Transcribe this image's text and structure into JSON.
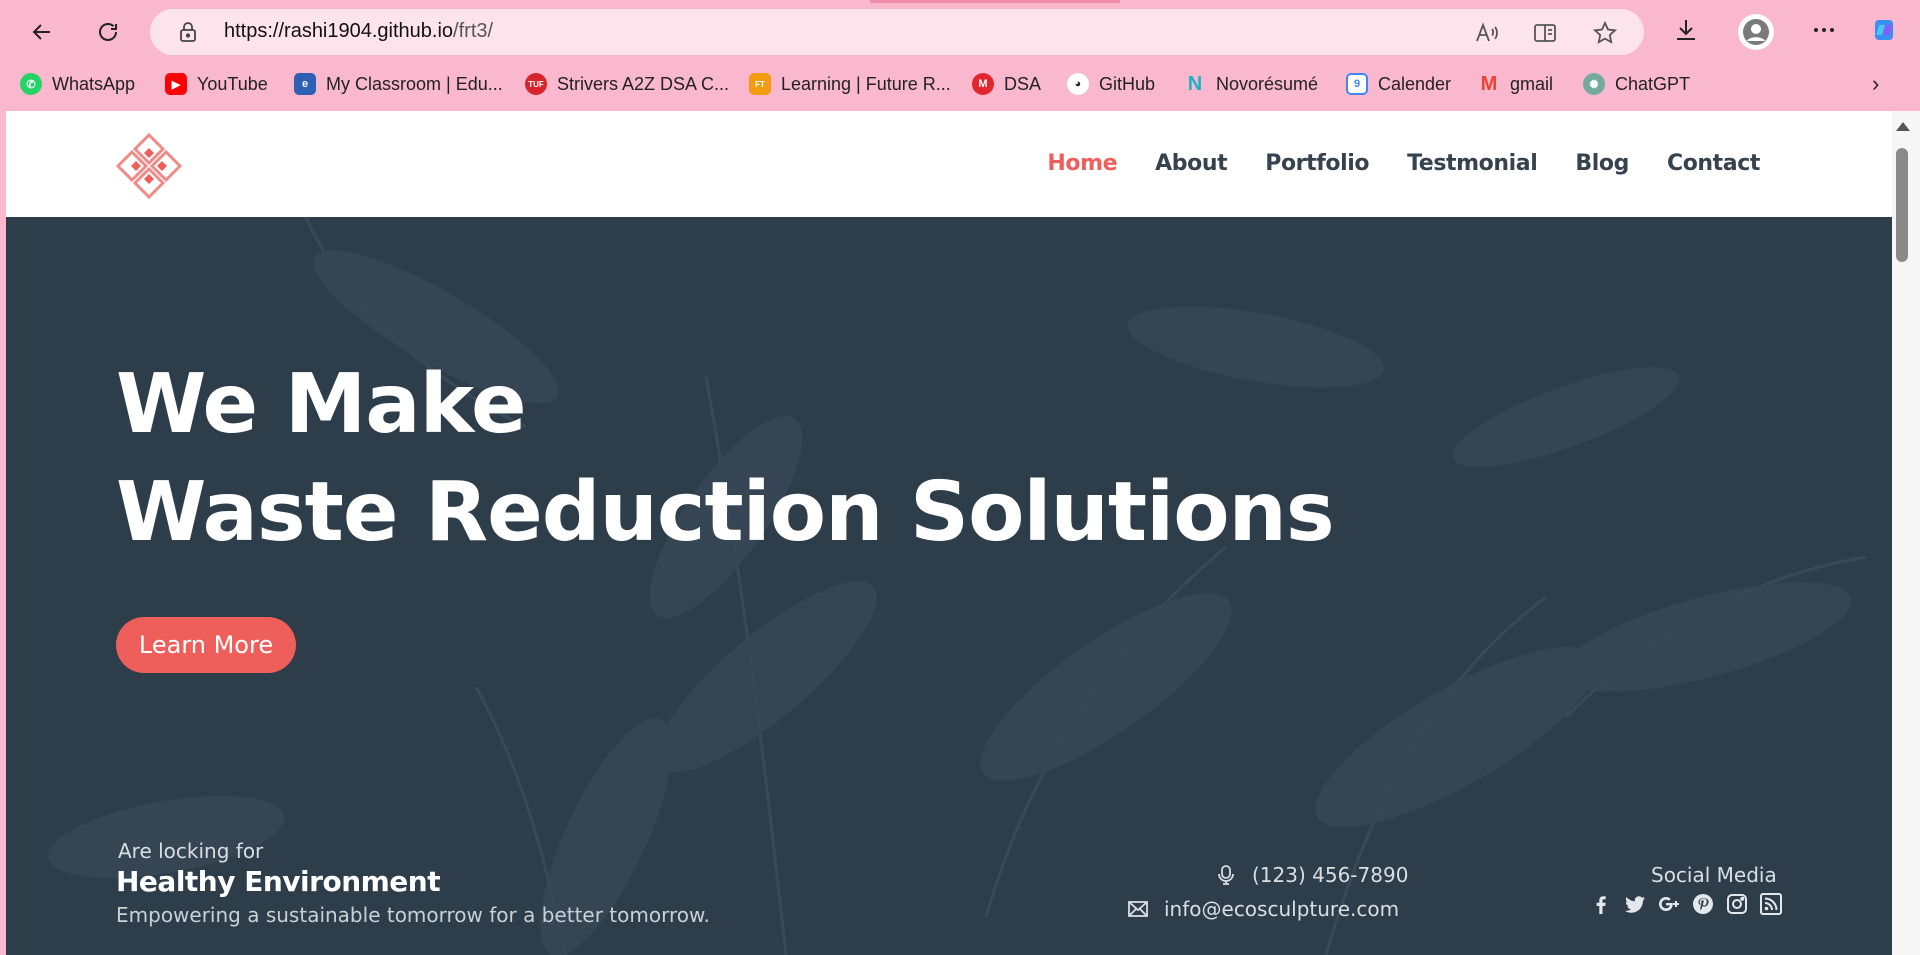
{
  "browser": {
    "url_host": "https://rashi1904.github.io",
    "url_path": "/frt3/",
    "bookmarks": [
      {
        "label": "WhatsApp",
        "icon": "whatsapp-icon",
        "color": "#25d366"
      },
      {
        "label": "YouTube",
        "icon": "youtube-icon",
        "color": "#ff0000"
      },
      {
        "label": "My Classroom | Edu...",
        "icon": "classroom-icon",
        "color": "#2d5fb3"
      },
      {
        "label": "Strivers A2Z DSA C...",
        "icon": "tuf-icon",
        "color": "#d9232d"
      },
      {
        "label": "Learning | Future R...",
        "icon": "future-talent-icon",
        "color": "#f39c12"
      },
      {
        "label": "DSA",
        "icon": "dsa-icon",
        "color": "#e3262e"
      },
      {
        "label": "GitHub",
        "icon": "github-icon",
        "color": "#ffffff"
      },
      {
        "label": "Novorésumé",
        "icon": "novoresume-icon",
        "color": "#1bb3c4"
      },
      {
        "label": "Calender",
        "icon": "calendar-icon",
        "color": "#4285f4"
      },
      {
        "label": "gmail",
        "icon": "gmail-icon",
        "color": "#ea4335"
      },
      {
        "label": "ChatGPT",
        "icon": "chatgpt-icon",
        "color": "#74aa9c"
      }
    ]
  },
  "site": {
    "nav": [
      "Home",
      "About",
      "Portfolio",
      "Testmonial",
      "Blog",
      "Contact"
    ],
    "active_nav": "Home",
    "headline_line1": "We Make",
    "headline_line2": "Waste Reduction Solutions",
    "cta_label": "Learn More",
    "looking_label": "Are locking for",
    "healthy_label": "Healthy Environment",
    "tagline": "Empowering a sustainable tomorrow for a better tomorrow.",
    "phone": "(123) 456-7890",
    "email": "info@ecosculpture.com",
    "social_title": "Social Media",
    "social_icons": [
      "facebook-icon",
      "twitter-icon",
      "google-plus-icon",
      "pinterest-icon",
      "instagram-icon",
      "rss-icon"
    ]
  },
  "colors": {
    "accent": "#ee5f5b",
    "hero_bg": "#2e3d4a",
    "browser_chrome": "#f9b8cd"
  }
}
